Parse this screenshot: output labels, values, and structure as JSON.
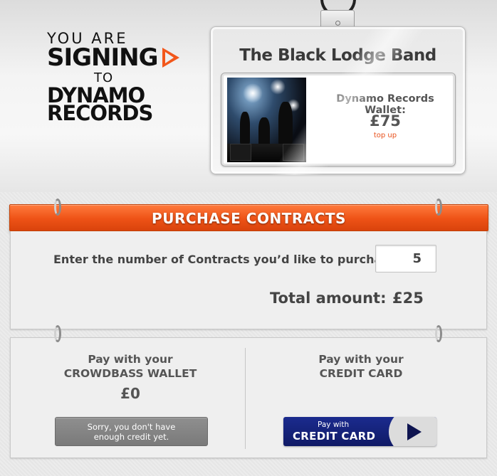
{
  "heading": {
    "line1": "YOU ARE",
    "line2": "SIGNING",
    "line3": "TO",
    "line4": "DYNAMO",
    "line5": "RECORDS"
  },
  "badge": {
    "band_name": "The Black Lodge Band",
    "wallet_label": "Dynamo Records Wallet:",
    "wallet_amount": "£75",
    "top_up_label": "top up"
  },
  "purchase": {
    "title": "PURCHASE CONTRACTS",
    "quantity_prompt": "Enter the number of Contracts you’d like to purchase:",
    "quantity_value": "5",
    "total_label": "Total amount:",
    "total_value": "£25"
  },
  "payment": {
    "wallet_option": {
      "line1": "Pay with your",
      "line2": "CROWDBASS WALLET",
      "balance": "£0",
      "disabled_line1": "Sorry, you don't have",
      "disabled_line2": "enough credit yet."
    },
    "card_option": {
      "line1": "Pay with your",
      "line2": "CREDIT CARD",
      "button_line1": "Pay with",
      "button_line2": "CREDIT CARD"
    }
  },
  "colors": {
    "accent": "#ee5216",
    "card_button": "#1b2b8e",
    "link": "#e8501b"
  }
}
